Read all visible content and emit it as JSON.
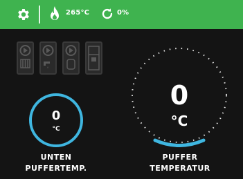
{
  "status_bar": {
    "temperature": "265°C",
    "percentage": "0%"
  },
  "left_sensor": {
    "value": "0",
    "unit": "°C",
    "label_line1": "UNTEN",
    "label_line2": "PUFFERTEMP."
  },
  "right_sensor": {
    "value": "0",
    "unit": "°C",
    "label_line1": "PUFFER",
    "label_line2": "TEMPERATUR"
  },
  "colors": {
    "status_bar": "#3fb34f",
    "gauge_accent": "#3fb6e0",
    "background": "#141414"
  }
}
